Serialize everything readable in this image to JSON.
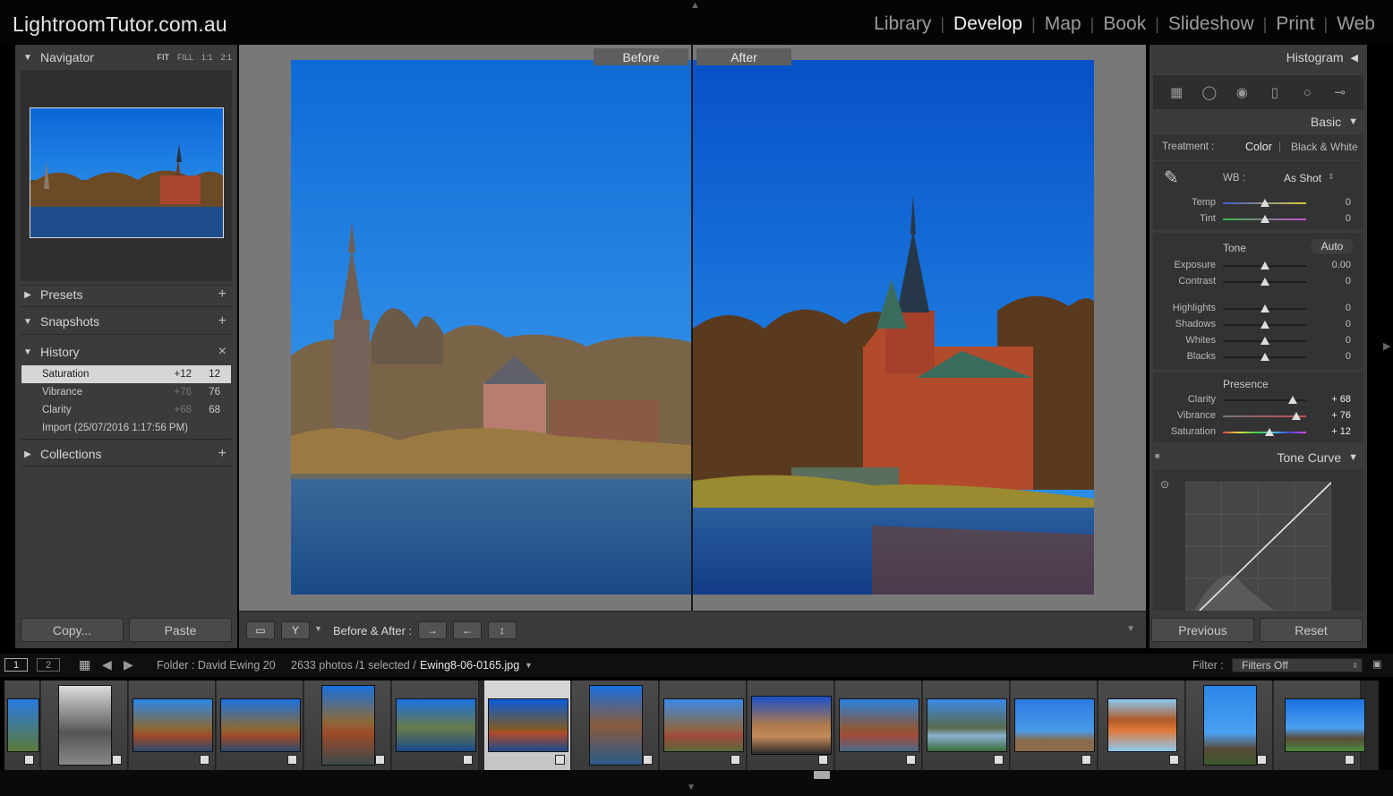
{
  "app": {
    "brand": "LightroomTutor.com.au",
    "modules": [
      "Library",
      "Develop",
      "Map",
      "Book",
      "Slideshow",
      "Print",
      "Web"
    ],
    "active_module": "Develop"
  },
  "left_panel": {
    "navigator": {
      "title": "Navigator",
      "options": [
        "FIT",
        "FILL",
        "1:1",
        "2:1"
      ]
    },
    "presets": {
      "title": "Presets"
    },
    "snapshots": {
      "title": "Snapshots"
    },
    "history": {
      "title": "History",
      "close": "×",
      "items": [
        {
          "label": "Saturation",
          "change": "+12",
          "value": "12",
          "selected": true
        },
        {
          "label": "Vibrance",
          "change": "+76",
          "value": "76",
          "selected": false
        },
        {
          "label": "Clarity",
          "change": "+68",
          "value": "68",
          "selected": false
        },
        {
          "label": "Import (25/07/2016 1:17:56 PM)",
          "change": "",
          "value": "",
          "selected": false
        }
      ]
    },
    "collections": {
      "title": "Collections"
    },
    "copy_label": "Copy...",
    "paste_label": "Paste"
  },
  "center": {
    "before_label": "Before",
    "after_label": "After",
    "toolbar_label": "Before & After :"
  },
  "right_panel": {
    "histogram_title": "Histogram",
    "basic_title": "Basic",
    "treatment_label": "Treatment :",
    "treatment_color": "Color",
    "treatment_bw": "Black & White",
    "wb_label": "WB :",
    "wb_value": "As Shot",
    "temp": {
      "label": "Temp",
      "value": "0",
      "position": 0.5
    },
    "tint": {
      "label": "Tint",
      "value": "0",
      "position": 0.5
    },
    "tone_label": "Tone",
    "auto_label": "Auto",
    "tone": [
      {
        "label": "Exposure",
        "value": "0.00",
        "position": 0.5
      },
      {
        "label": "Contrast",
        "value": "0",
        "position": 0.5
      }
    ],
    "tone2": [
      {
        "label": "Highlights",
        "value": "0",
        "position": 0.5
      },
      {
        "label": "Shadows",
        "value": "0",
        "position": 0.5
      },
      {
        "label": "Whites",
        "value": "0",
        "position": 0.5
      },
      {
        "label": "Blacks",
        "value": "0",
        "position": 0.5
      }
    ],
    "presence_label": "Presence",
    "presence": [
      {
        "label": "Clarity",
        "value": "+ 68",
        "position": 0.84
      },
      {
        "label": "Vibrance",
        "value": "+ 76",
        "position": 0.88
      },
      {
        "label": "Saturation",
        "value": "+ 12",
        "position": 0.56
      }
    ],
    "tone_curve_title": "Tone Curve",
    "previous_label": "Previous",
    "reset_label": "Reset"
  },
  "filmstrip_info": {
    "screen1": "1",
    "screen2": "2",
    "folder": "Folder : David Ewing 20",
    "count": "2633 photos /1 selected /",
    "filename": "Ewing8-06-0165.jpg",
    "filter_label": "Filter :",
    "filter_value": "Filters Off"
  },
  "colors": {
    "panel_bg": "#3b3b3b",
    "sky": "#1f8fe6",
    "active_text": "#f2f2f2"
  }
}
